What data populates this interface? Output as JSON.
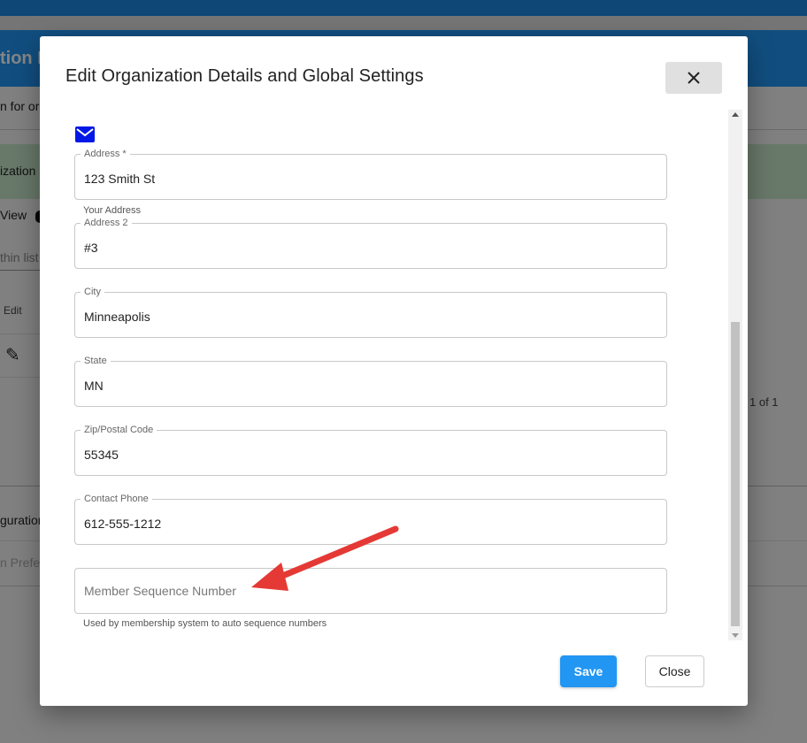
{
  "background": {
    "header_title": "tion I",
    "subtitle": "n for or",
    "banner_text": "ization",
    "view_label": "View",
    "search_placeholder": "thin list",
    "edit_column": "Edit",
    "pagination": "1 of 1",
    "configuration_label": "guration",
    "preferences_label": "n Prefe"
  },
  "dialog": {
    "title": "Edit Organization Details and Global Settings",
    "close_icon": "close-icon",
    "email_icon": "mail-icon",
    "fields": [
      {
        "label": "Address *",
        "value": "123 Smith St",
        "hint": "Your Address"
      },
      {
        "label": "Address 2",
        "value": "#3"
      },
      {
        "label": "City",
        "value": "Minneapolis"
      },
      {
        "label": "State",
        "value": "MN"
      },
      {
        "label": "Zip/Postal Code",
        "value": "55345"
      },
      {
        "label": "Contact Phone",
        "value": "612-555-1212"
      },
      {
        "placeholder": "Member Sequence Number",
        "value": "",
        "hint": "Used by membership system to auto sequence numbers"
      }
    ],
    "save_label": "Save",
    "close_label": "Close"
  },
  "colors": {
    "primary": "#2196f3",
    "annotation_arrow": "#e53935"
  }
}
